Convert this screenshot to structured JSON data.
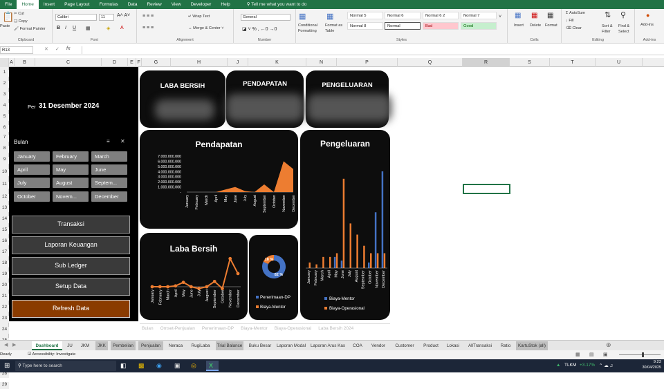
{
  "menu": {
    "tabs": [
      "File",
      "Home",
      "Insert",
      "Page Layout",
      "Formulas",
      "Data",
      "Review",
      "View",
      "Developer",
      "Help"
    ],
    "tell_me": "Tell me what you want to do"
  },
  "ribbon": {
    "clipboard": {
      "paste": "Paste",
      "cut": "Cut",
      "copy": "Copy",
      "format_painter": "Format Painter",
      "group": "Clipboard"
    },
    "font": {
      "name": "Calibri",
      "size": "11",
      "group": "Font"
    },
    "alignment": {
      "wrap": "Wrap Text",
      "merge": "Merge & Center",
      "group": "Alignment"
    },
    "number": {
      "format": "General",
      "group": "Number"
    },
    "styles": {
      "conditional": "Conditional Formatting",
      "format_table": "Format as Table",
      "cells": [
        "Normal 5",
        "Normal 6",
        "Normal 6 2",
        "Normal 7",
        "Normal 8",
        "Normal",
        "Bad",
        "Good"
      ],
      "group": "Styles"
    },
    "cells": {
      "insert": "Insert",
      "delete": "Delete",
      "format": "Format",
      "group": "Cells"
    },
    "editing": {
      "autosum": "AutoSum",
      "fill": "Fill",
      "clear": "Clear",
      "sort": "Sort & Filter",
      "find": "Find & Select",
      "group": "Editing"
    },
    "addins": {
      "label": "Add-ins",
      "group": "Add-ins"
    }
  },
  "formula_bar": {
    "name_box": "R13",
    "fx": "fx",
    "value": ""
  },
  "columns": [
    "A",
    "B",
    "C",
    "D",
    "E",
    "F",
    "G",
    "H",
    "J",
    "K",
    "N",
    "P",
    "Q",
    "R",
    "S",
    "T",
    "U"
  ],
  "rows": [
    "1",
    "2",
    "3",
    "4",
    "5",
    "6",
    "7",
    "8",
    "9",
    "10",
    "11",
    "12",
    "13",
    "14",
    "15",
    "16",
    "17",
    "18",
    "19",
    "20",
    "21",
    "22",
    "23",
    "24",
    "25",
    "26",
    "27",
    "28",
    "29"
  ],
  "panel": {
    "per_label": "Per",
    "date": "31 Desember 2024",
    "bulan_label": "Bulan",
    "months": [
      "January",
      "February",
      "March",
      "April",
      "May",
      "June",
      "July",
      "August",
      "Septem...",
      "October",
      "Novem...",
      "December"
    ],
    "nav": [
      "Transaksi",
      "Laporan Keuangan",
      "Sub Ledger",
      "Setup Data",
      "Refresh Data"
    ]
  },
  "kpis": [
    {
      "title": "LABA BERSIH"
    },
    {
      "title": "PENDAPATAN"
    },
    {
      "title": "PENGELUARAN"
    }
  ],
  "chart_data": [
    {
      "type": "area",
      "title": "Pendapatan",
      "categories": [
        "January",
        "February",
        "March",
        "April",
        "May",
        "June",
        "July",
        "August",
        "September",
        "October",
        "November",
        "December"
      ],
      "values": [
        0,
        0,
        0,
        0,
        500000,
        1000000,
        200000,
        0,
        1500000,
        0,
        6000000,
        4500000
      ],
      "ylim": [
        0,
        7000000
      ],
      "yticks": [
        "7.000.000.000",
        "6.000.000.000",
        "5.000.000.000",
        "4.000.000.000",
        "3.000.000.000",
        "2.000.000.000",
        "1.000.000.000",
        "-"
      ],
      "color": "#ed7d31"
    },
    {
      "type": "bar",
      "title": "Pengeluaran",
      "categories": [
        "January",
        "February",
        "March",
        "April",
        "May",
        "June",
        "July",
        "August",
        "September",
        "October",
        "November",
        "December"
      ],
      "series": [
        {
          "name": "Biaya-Mentor",
          "color": "#4472c4",
          "values": [
            0,
            0,
            0,
            0,
            0.3,
            0.2,
            0,
            0,
            0,
            0.15,
            1.5,
            2.6
          ]
        },
        {
          "name": "Biaya-Operasional",
          "color": "#ed7d31",
          "values": [
            0.15,
            0.1,
            0.3,
            0.3,
            0.4,
            2.4,
            1.2,
            0.9,
            0.6,
            0.4,
            0.4,
            0.4
          ]
        }
      ],
      "legend": "bottom"
    },
    {
      "type": "line",
      "title": "Laba Bersih",
      "categories": [
        "January",
        "February",
        "March",
        "April",
        "May",
        "June",
        "July",
        "August",
        "September",
        "October",
        "November",
        "December"
      ],
      "values": [
        0,
        0,
        0,
        0.1,
        0.5,
        0,
        -0.2,
        0,
        0.6,
        -0.2,
        3.2,
        1.5
      ],
      "color": "#ed7d31"
    },
    {
      "type": "pie",
      "slices": [
        {
          "name": "Penerimaan-DP",
          "value": 82,
          "label": "82 %",
          "color": "#4472c4"
        },
        {
          "name": "Biaya-Mentor",
          "value": 18,
          "label": "18 %",
          "color": "#ed7d31"
        }
      ],
      "legend": "bottom"
    }
  ],
  "slicer_strip": [
    "Bulan",
    "Omset-Penjualan",
    "Penerimaan-DP",
    "Biaya-Mentor",
    "Biaya-Operasional",
    "Laba Bersih 2024"
  ],
  "sheet_tabs": [
    "Dashboard",
    "JU",
    "JKM",
    "JKK",
    "Pembelian",
    "Penjualan",
    "Neraca",
    "RugiLaba",
    "Trial Balance",
    "Buku Besar",
    "Laporan Modal",
    "Laporan Arus Kas",
    "COA",
    "Vendor",
    "Customer",
    "Product",
    "Lokasi",
    "AllTransaksi",
    "Ratio",
    "KartuStok (all)"
  ],
  "status": {
    "ready": "Ready",
    "accessibility": "Accessibility: Investigate"
  },
  "taskbar": {
    "search": "Type here to search",
    "ticker": "TLKM",
    "change": "+3.17%",
    "time": "9:23",
    "date": "30/04/2025"
  }
}
